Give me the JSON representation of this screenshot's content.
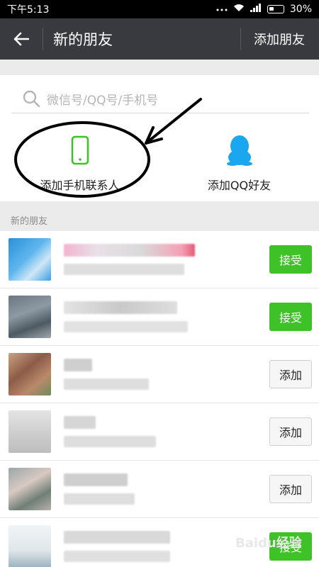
{
  "status_bar": {
    "time": "下午5:13",
    "battery": "30%"
  },
  "header": {
    "title": "新的朋友",
    "add_friend": "添加朋友"
  },
  "search": {
    "placeholder": "微信号/QQ号/手机号"
  },
  "options": [
    {
      "label": "添加手机联系人",
      "icon": "phone-icon"
    },
    {
      "label": "添加QQ好友",
      "icon": "qq-penguin-icon"
    }
  ],
  "section": {
    "title": "新的朋友"
  },
  "requests": [
    {
      "action": "接受",
      "status": "accept"
    },
    {
      "action": "接受",
      "status": "accept"
    },
    {
      "action": "添加",
      "status": "add"
    },
    {
      "action": "添加",
      "status": "add"
    },
    {
      "action": "添加",
      "status": "add"
    },
    {
      "action": "接受",
      "status": "accept"
    }
  ],
  "colors": {
    "title_bar": "#393a3f",
    "accept_green": "#3fc128",
    "phone_icon_green": "#3fc128",
    "qq_icon_blue": "#1aa7f0"
  },
  "watermark": "Baidu经验"
}
